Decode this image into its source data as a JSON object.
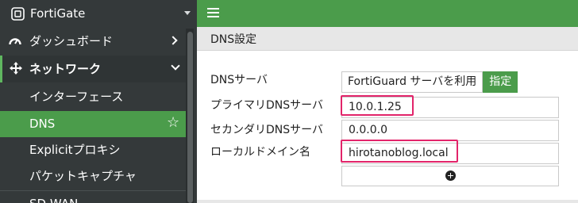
{
  "brand": {
    "name": "FortiGate",
    "icon": "fortigate-logo-icon"
  },
  "sidebar": {
    "items": [
      {
        "label": "ダッシュボード",
        "icon": "dashboard-icon",
        "expand": "chevron-right"
      },
      {
        "label": "ネットワーク",
        "icon": "network-icon",
        "expand": "chevron-down",
        "expanded": true
      },
      {
        "label": "インターフェース"
      },
      {
        "label": "DNS",
        "active": true,
        "favorite_icon": "star-icon"
      },
      {
        "label": "Explicitプロキシ"
      },
      {
        "label": "パケットキャプチャ"
      },
      {
        "label": "SD-WAN"
      }
    ]
  },
  "topbar": {
    "menu_icon": "hamburger-icon"
  },
  "section": {
    "title": "DNS設定"
  },
  "form": {
    "dns_server_label": "DNSサーバ",
    "dns_server_options": [
      "FortiGuard サーバを利用",
      "指定"
    ],
    "dns_server_selected": "指定",
    "primary_label": "プライマリDNSサーバ",
    "primary_value": "10.0.1.25",
    "secondary_label": "セカンダリDNSサーバ",
    "secondary_value": "0.0.0.0",
    "local_domain_label": "ローカルドメイン名",
    "local_domain_value": "hirotanoblog.local",
    "add_icon": "plus-circle-icon"
  },
  "colors": {
    "accent_green": "#4b9c4b",
    "sidebar_bg": "#34393a",
    "highlight": "#e2246a"
  }
}
